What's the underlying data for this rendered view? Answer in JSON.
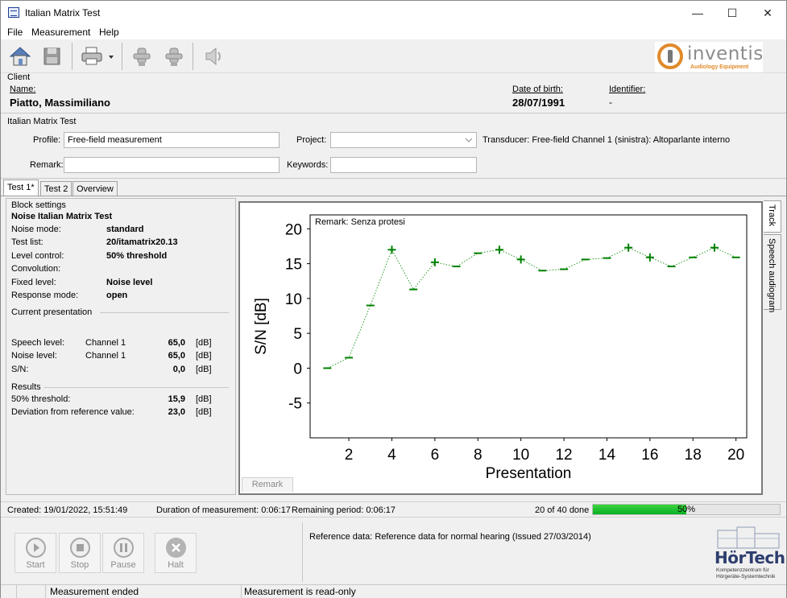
{
  "window": {
    "title": "Italian Matrix Test",
    "minimize": "—",
    "maximize": "☐",
    "close": "✕"
  },
  "menu": [
    "File",
    "Measurement",
    "Help"
  ],
  "logo": {
    "word": "inventis",
    "sub": "Audiology Equipment"
  },
  "client": {
    "section": "Client",
    "name_label": "Name:",
    "name": "Piatto, Massimiliano",
    "dob_label": "Date of birth:",
    "dob": "28/07/1991",
    "id_label": "Identifier:",
    "id": "-"
  },
  "test": {
    "section": "Italian Matrix Test",
    "profile_label": "Profile:",
    "profile": "Free-field measurement",
    "project_label": "Project:",
    "project": "",
    "transducer": "Transducer: Free-field  Channel 1 (sinistra): Altoparlante interno",
    "remark_label": "Remark:",
    "remark": "",
    "keywords_label": "Keywords:",
    "keywords": ""
  },
  "tabs": [
    "Test 1*",
    "Test 2",
    "Overview"
  ],
  "vtabs": [
    "Track",
    "Speech audiogram"
  ],
  "block": {
    "title": "Block settings",
    "name": "Noise Italian Matrix Test",
    "rows": [
      {
        "k": "Noise mode:",
        "v": "standard"
      },
      {
        "k": "Test list:",
        "v": "20/itamatrix20.13"
      },
      {
        "k": "Level control:",
        "v": "50% threshold"
      },
      {
        "k": "Convolution:",
        "v": ""
      },
      {
        "k": "Fixed level:",
        "v": "Noise level"
      },
      {
        "k": "Response mode:",
        "v": "open"
      }
    ]
  },
  "current": {
    "title": "Current presentation",
    "rows": [
      {
        "k": "Speech level:",
        "ch": "Channel 1",
        "v": "65,0",
        "u": "[dB]"
      },
      {
        "k": "Noise level:",
        "ch": "Channel 1",
        "v": "65,0",
        "u": "[dB]"
      },
      {
        "k": "S/N:",
        "ch": "",
        "v": "0,0",
        "u": "[dB]"
      }
    ]
  },
  "results": {
    "title": "Results",
    "rows": [
      {
        "k": "50% threshold:",
        "v": "15,9",
        "u": "[dB]"
      },
      {
        "k": "Deviation from reference value:",
        "v": "23,0",
        "u": "[dB]"
      }
    ]
  },
  "chart_data": {
    "type": "scatter",
    "annotation": "Remark: Senza protesi",
    "xlabel": "Presentation",
    "ylabel": "S/N [dB]",
    "xlim": [
      0.2,
      20.5
    ],
    "ylim": [
      -10,
      22
    ],
    "xticks": [
      2,
      4,
      6,
      8,
      10,
      12,
      14,
      16,
      18,
      20
    ],
    "yticks": [
      -5,
      0,
      5,
      10,
      15,
      20
    ],
    "points": [
      {
        "x": 1,
        "y": 0.0,
        "m": "-"
      },
      {
        "x": 2,
        "y": 1.5,
        "m": "-"
      },
      {
        "x": 3,
        "y": 9.0,
        "m": "-"
      },
      {
        "x": 4,
        "y": 17.0,
        "m": "+"
      },
      {
        "x": 5,
        "y": 11.3,
        "m": "-"
      },
      {
        "x": 6,
        "y": 15.2,
        "m": "+"
      },
      {
        "x": 7,
        "y": 14.6,
        "m": "-"
      },
      {
        "x": 8,
        "y": 16.5,
        "m": "-"
      },
      {
        "x": 9,
        "y": 17.0,
        "m": "+"
      },
      {
        "x": 10,
        "y": 15.6,
        "m": "+"
      },
      {
        "x": 11,
        "y": 14.0,
        "m": "-"
      },
      {
        "x": 12,
        "y": 14.2,
        "m": "-"
      },
      {
        "x": 13,
        "y": 15.6,
        "m": "-"
      },
      {
        "x": 14,
        "y": 15.8,
        "m": "-"
      },
      {
        "x": 15,
        "y": 17.3,
        "m": "+"
      },
      {
        "x": 16,
        "y": 15.9,
        "m": "+"
      },
      {
        "x": 17,
        "y": 14.6,
        "m": "-"
      },
      {
        "x": 18,
        "y": 15.9,
        "m": "-"
      },
      {
        "x": 19,
        "y": 17.3,
        "m": "+"
      },
      {
        "x": 20,
        "y": 15.9,
        "m": "-"
      }
    ],
    "color": "#008000"
  },
  "chart_tab": "Remark",
  "status": {
    "created": "Created: 19/01/2022, 15:51:49",
    "duration": "Duration of measurement: 0:06:17",
    "remaining": "Remaining period: 0:06:17",
    "done": "20 of 40 done",
    "progress_pct": 50,
    "progress_label": "50%"
  },
  "controls": [
    "Start",
    "Stop",
    "Pause",
    "Halt"
  ],
  "reference": "Reference data: Reference data for normal hearing (Issued 27/03/2014)",
  "hortech": {
    "word": "HörTech",
    "sub1": "Kompetenzzentrum für",
    "sub2": "Hörgeräte-Systemtechnik"
  },
  "bottom": {
    "left": "Measurement ended",
    "right": "Measurement is read-only"
  }
}
